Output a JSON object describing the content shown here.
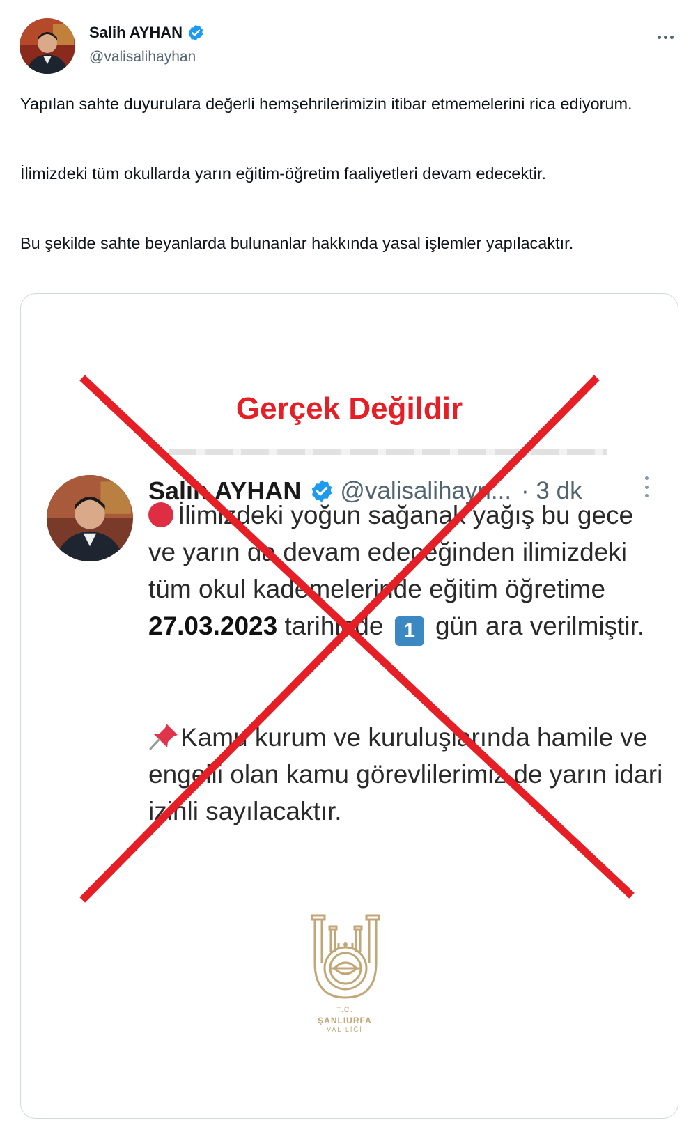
{
  "author": {
    "display_name": "Salih AYHAN",
    "handle": "@valisalihayhan",
    "verified": true
  },
  "tweet": {
    "paragraphs": [
      "Yapılan sahte duyurulara değerli hemşehrilerimizin itibar etmemelerini rica ediyorum.",
      "İlimizdeki tüm okullarda yarın eğitim-öğretim faaliyetleri devam edecektir.",
      "Bu şekilde sahte beyanlarda bulunanlar hakkında yasal işlemler yapılacaktır."
    ]
  },
  "media": {
    "fake_label": "Gerçek Değildir",
    "quoted": {
      "display_name": "Salih AYHAN",
      "handle": "@valisalihayn...",
      "time": "· 3 dk",
      "text_a1": "İlimizdeki yoğun sağanak yağış bu gece ve yarın da devam edeceğinden ilimizdeki tüm okul kademelerinde eğitim öğretime ",
      "date": "27.03.2023",
      "text_a2": " tarihinde",
      "keycap": "1",
      "text_a3": "gün ara verilmiştir.",
      "text_b": "Kamu kurum ve kuruluşlarında hamile ve engelli olan kamu görevlilerimiz de yarın idari izinli sayılacaktır."
    },
    "logo": {
      "tc": "T.C.",
      "city": "ŞANLIURFA",
      "office": "VALİLİĞİ"
    }
  },
  "colors": {
    "cross": "#e61e25",
    "verified": "#1d9bf0",
    "logo_gold": "#c2a676"
  },
  "icons": [
    "verified-badge-icon",
    "more-options-icon",
    "red-circle-icon",
    "keycap-one-icon",
    "pushpin-icon"
  ]
}
